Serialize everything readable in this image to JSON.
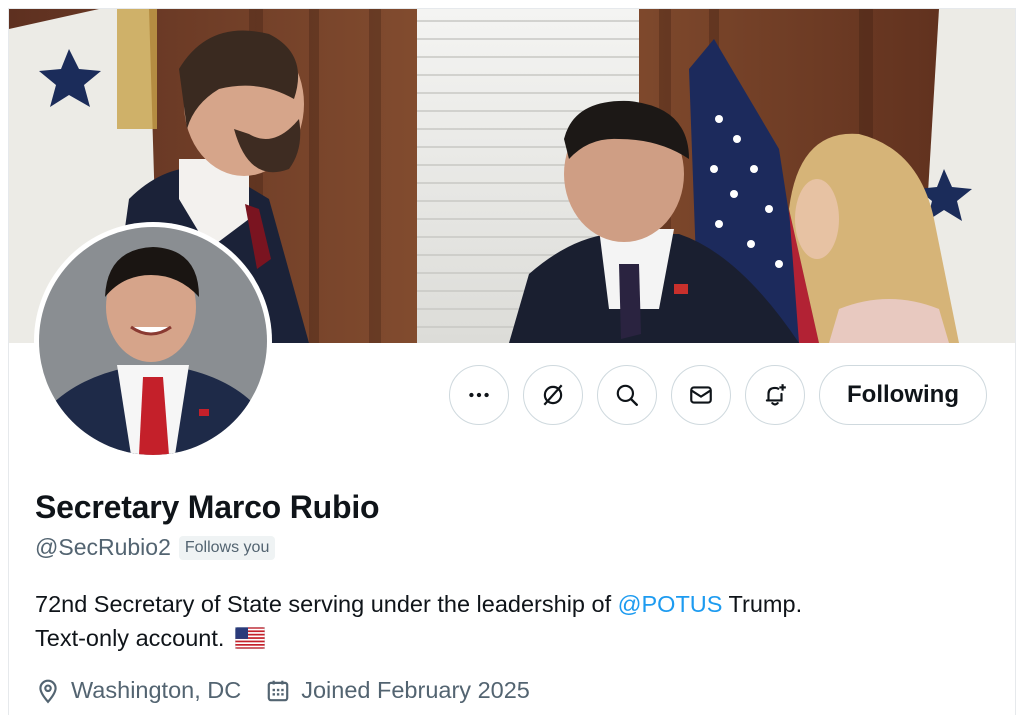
{
  "profile": {
    "display_name": "Secretary Marco Rubio",
    "handle": "@SecRubio2",
    "follows_you_label": "Follows you",
    "bio_prefix": "72nd Secretary of State serving under the leadership of ",
    "bio_mention": "@POTUS",
    "bio_suffix": " Trump.",
    "bio_line2": "Text-only account.",
    "location": "Washington, DC",
    "joined": "Joined February 2025"
  },
  "actions": {
    "more_icon": "more-icon",
    "grok_icon": "grok-icon",
    "search_icon": "search-icon",
    "message_icon": "message-icon",
    "notify_icon": "notification-bell-icon",
    "follow_label": "Following"
  },
  "colors": {
    "accent": "#1d9bf0",
    "secondary_text": "#536471",
    "border": "#cfd9de"
  }
}
